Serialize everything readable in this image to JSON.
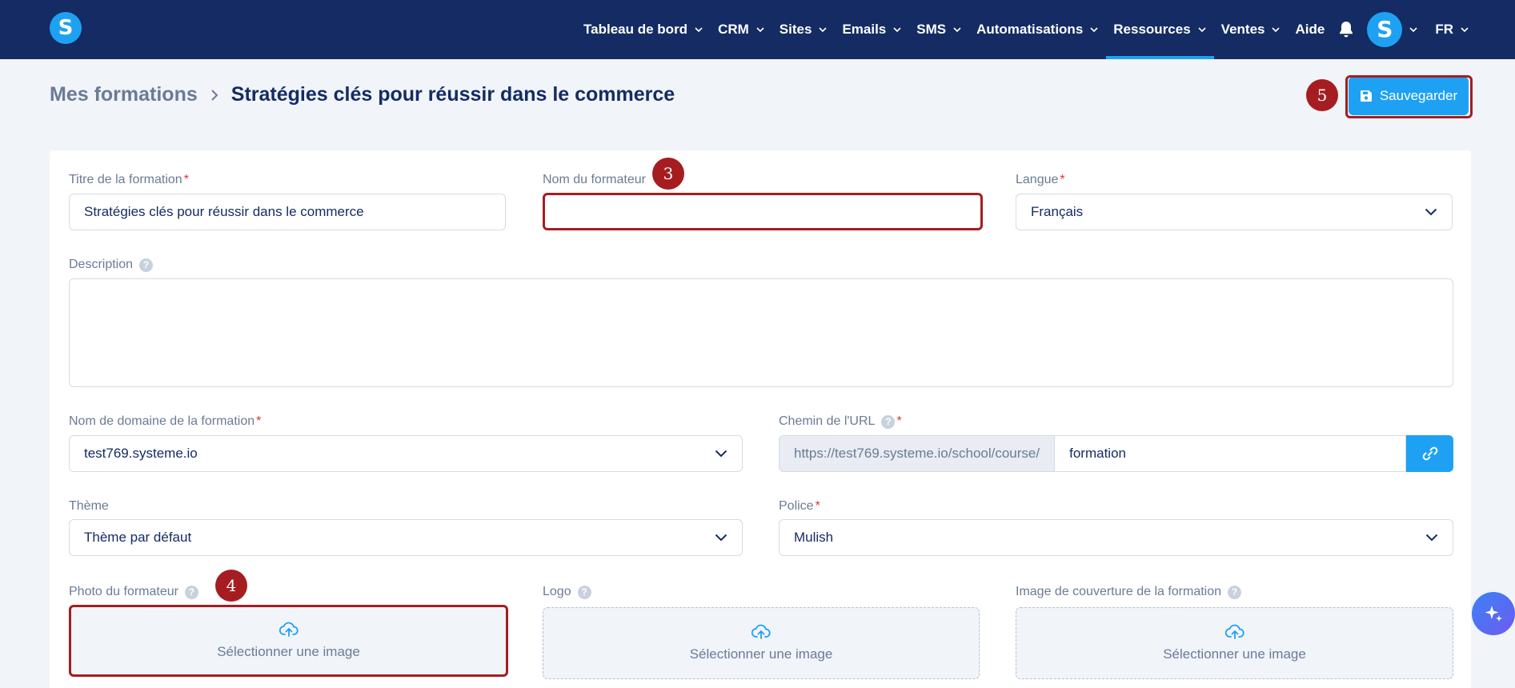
{
  "nav": {
    "logo_letter": "S",
    "items": [
      {
        "label": "Tableau de bord"
      },
      {
        "label": "CRM"
      },
      {
        "label": "Sites"
      },
      {
        "label": "Emails"
      },
      {
        "label": "SMS"
      },
      {
        "label": "Automatisations"
      },
      {
        "label": "Ressources",
        "active": true
      },
      {
        "label": "Ventes"
      },
      {
        "label": "Aide"
      }
    ],
    "avatar_letter": "S",
    "language": "FR"
  },
  "header": {
    "breadcrumb_parent": "Mes formations",
    "breadcrumb_current": "Stratégies clés pour réussir dans le commerce",
    "save_label": "Sauvegarder"
  },
  "markers": {
    "trainer_name": "3",
    "trainer_photo": "4",
    "save": "5"
  },
  "form": {
    "title_label": "Titre de la formation",
    "title_value": "Stratégies clés pour réussir dans le commerce",
    "trainer_label": "Nom du formateur",
    "trainer_value": "",
    "language_label": "Langue",
    "language_value": "Français",
    "description_label": "Description",
    "domain_label": "Nom de domaine de la formation",
    "domain_value": "test769.systeme.io",
    "url_label": "Chemin de l'URL",
    "url_prefix": "https://test769.systeme.io/school/course/",
    "url_value": "formation",
    "theme_label": "Thème",
    "theme_value": "Thème par défaut",
    "font_label": "Police",
    "font_value": "Mulish",
    "photo_label": "Photo du formateur",
    "logo_label": "Logo",
    "cover_label": "Image de couverture de la formation",
    "select_image": "Sélectionner une image",
    "required_mark": "*",
    "help_mark": "?"
  },
  "colors": {
    "nav_bg": "#142c63",
    "accent": "#1ea1f3",
    "marker": "#a51d21"
  },
  "icons": [
    "bell-icon",
    "chevron-down-icon",
    "save-icon",
    "link-icon",
    "upload-cloud-icon",
    "sparkle-icon"
  ]
}
